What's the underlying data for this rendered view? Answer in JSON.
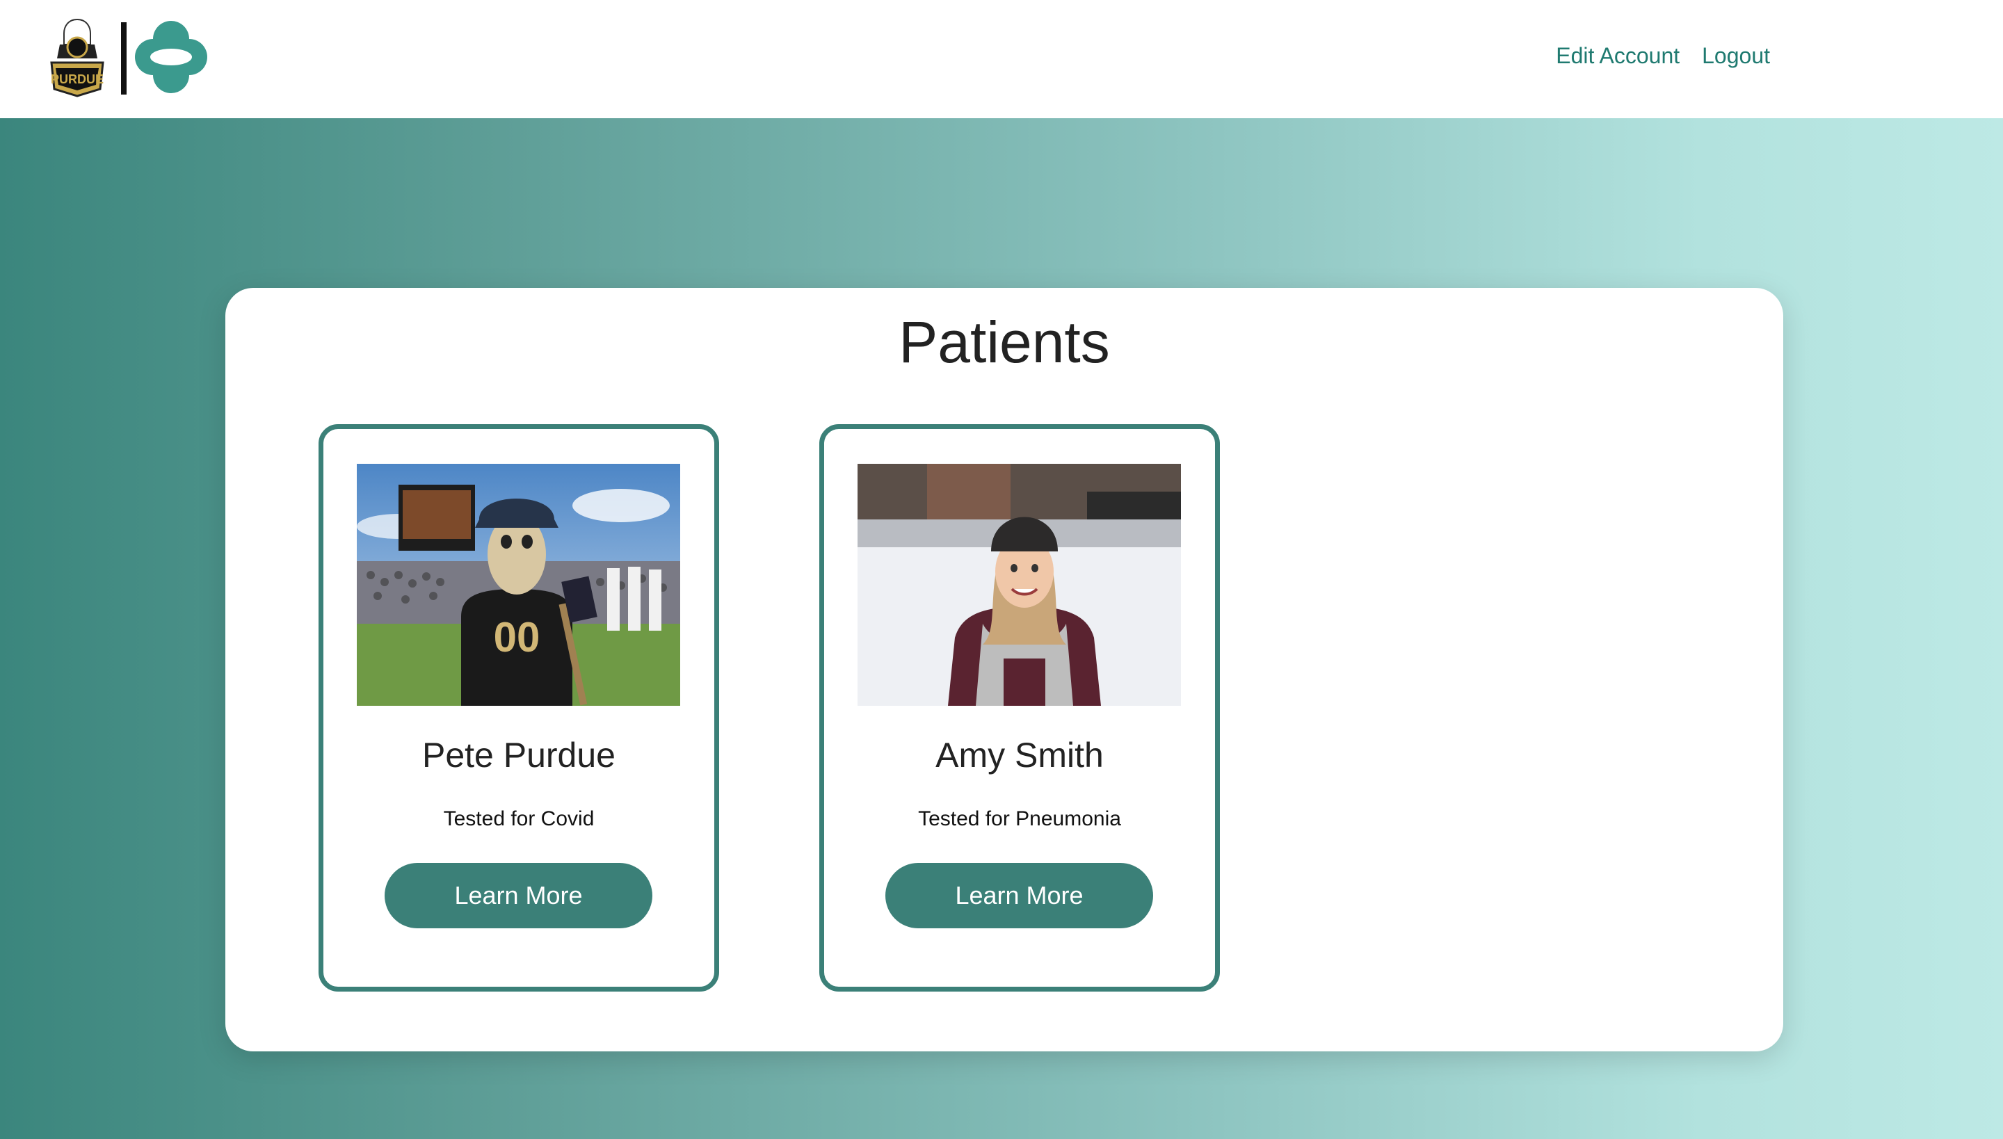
{
  "header": {
    "logos": [
      "purdue-logo",
      "merck-logo"
    ],
    "nav": {
      "edit_account": "Edit Account",
      "logout": "Logout"
    }
  },
  "main": {
    "title": "Patients",
    "patients": [
      {
        "name": "Pete Purdue",
        "test": "Tested for Covid",
        "button_label": "Learn More",
        "photo": "mascot-at-stadium-photo"
      },
      {
        "name": "Amy Smith",
        "test": "Tested for Pneumonia",
        "button_label": "Learn More",
        "photo": "woman-in-snow-photo"
      }
    ]
  },
  "colors": {
    "accent": "#3b8078",
    "nav_link": "#1f7a70",
    "gradient_start": "#3b867d",
    "gradient_end": "#bde9e5"
  }
}
